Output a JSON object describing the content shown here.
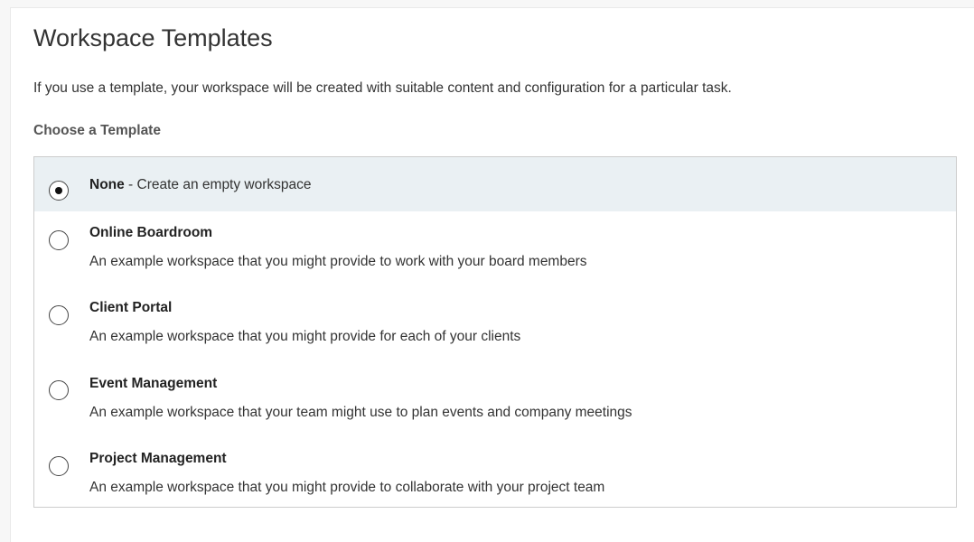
{
  "page": {
    "title": "Workspace Templates",
    "intro": "If you use a template, your workspace will be created with suitable content and configuration for a particular task.",
    "section_label": "Choose a Template"
  },
  "templates": [
    {
      "name": "None",
      "separator": " - ",
      "description": "Create an empty workspace",
      "selected": true
    },
    {
      "name": "Online Boardroom",
      "description": "An example workspace that you might provide to work with your board members",
      "selected": false
    },
    {
      "name": "Client Portal",
      "description": "An example workspace that you might provide for each of your clients",
      "selected": false
    },
    {
      "name": "Event Management",
      "description": "An example workspace that your team might use to plan events and company meetings",
      "selected": false
    },
    {
      "name": "Project Management",
      "description": "An example workspace that you might provide to collaborate with your project team",
      "selected": false
    }
  ],
  "colors": {
    "selected_row": "#eaf0f3",
    "border": "#cccccc",
    "text": "#333333"
  }
}
